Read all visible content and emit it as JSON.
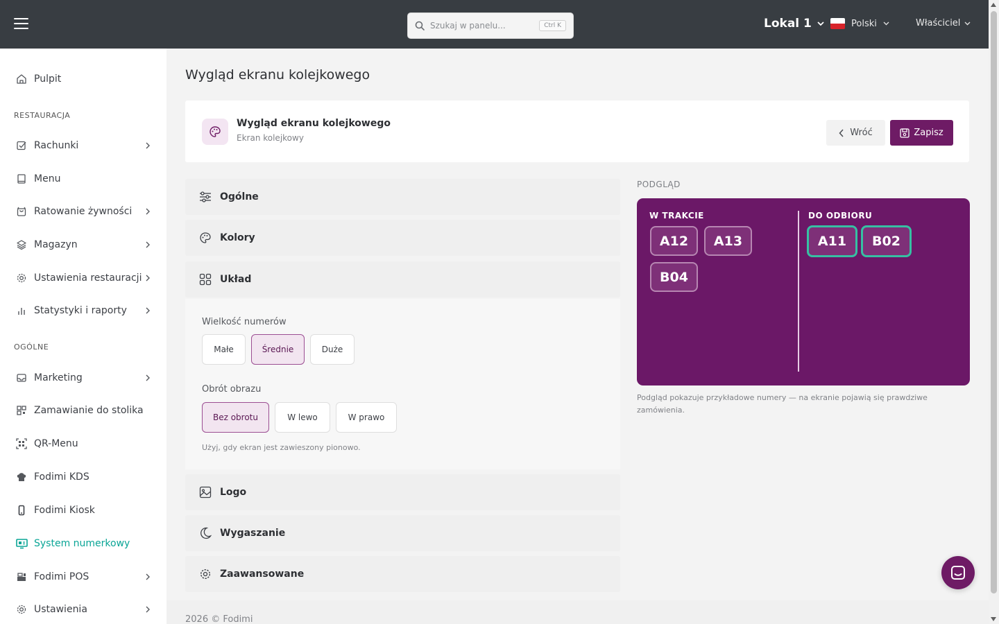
{
  "topbar": {
    "search_placeholder": "Szukaj w panelu...",
    "search_shortcut": "Ctrl K",
    "location": "Lokal 1",
    "language": "Polski",
    "role": "Właściciel"
  },
  "sidebar": {
    "items": [
      {
        "label": "Pulpit"
      },
      {
        "label": "Rachunki"
      },
      {
        "label": "Menu"
      },
      {
        "label": "Ratowanie żywności"
      },
      {
        "label": "Magazyn"
      },
      {
        "label": "Ustawienia restauracji"
      },
      {
        "label": "Statystyki i raporty"
      },
      {
        "label": "Marketing"
      },
      {
        "label": "Zamawianie do stolika"
      },
      {
        "label": "QR-Menu"
      },
      {
        "label": "Fodimi KDS"
      },
      {
        "label": "Fodimi Kiosk"
      },
      {
        "label": "System numerkowy"
      },
      {
        "label": "Fodimi POS"
      },
      {
        "label": "Ustawienia"
      }
    ],
    "sections": {
      "restaurant": "RESTAURACJA",
      "general": "OGÓLNE"
    }
  },
  "page": {
    "title": "Wygląd ekranu kolejkowego",
    "card_title": "Wygląd ekranu kolejkowego",
    "card_subtitle": "Ekran kolejkowy",
    "back_label": "Wróć",
    "save_label": "Zapisz"
  },
  "accordion": {
    "general": "Ogólne",
    "colors": "Kolory",
    "layout": "Układ",
    "logo": "Logo",
    "screensaver": "Wygaszanie",
    "advanced": "Zaawansowane"
  },
  "layout_panel": {
    "size_label": "Wielkość numerów",
    "size_options": [
      "Małe",
      "Średnie",
      "Duże"
    ],
    "size_selected": "Średnie",
    "rotation_label": "Obrót obrazu",
    "rotation_options": [
      "Bez obrotu",
      "W lewo",
      "W prawo"
    ],
    "rotation_selected": "Bez obrotu",
    "hint": "Użyj, gdy ekran jest zawieszony pionowo."
  },
  "preview": {
    "label": "PODGLĄD",
    "in_progress_label": "W TRAKCIE",
    "ready_label": "DO ODBIORU",
    "in_progress": [
      "A12",
      "A13",
      "B04"
    ],
    "ready": [
      "A11",
      "B02"
    ],
    "note": "Podgląd pokazuje przykładowe numery — na ekranie pojawią się prawdziwe zamówienia.",
    "bg_color": "#6b1867",
    "ready_border_color": "#36c0a3"
  },
  "footer": {
    "copyright": "2026 © Fodimi"
  },
  "colors": {
    "accent": "#6e1b65",
    "active_nav": "#0aa596",
    "topbar": "#383d42"
  }
}
